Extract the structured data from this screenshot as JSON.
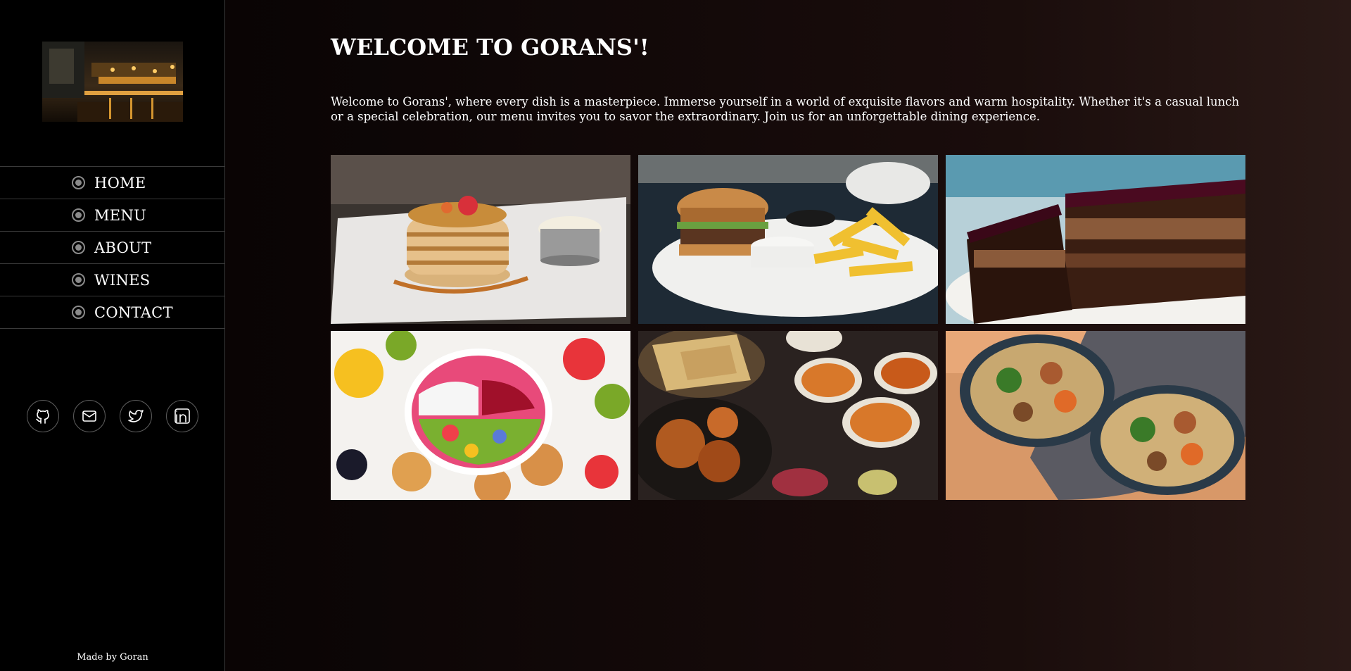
{
  "sidebar": {
    "logo": "restaurant-interior-photo",
    "nav": [
      {
        "label": "HOME"
      },
      {
        "label": "MENU"
      },
      {
        "label": "ABOUT"
      },
      {
        "label": "WINES"
      },
      {
        "label": "CONTACT"
      }
    ],
    "socials": [
      "github-icon",
      "mail-icon",
      "twitter-icon",
      "linkedin-icon"
    ],
    "credit": "Made by Goran"
  },
  "main": {
    "title": "WELCOME TO GORANS'!",
    "intro": "Welcome to Gorans', where every dish is a masterpiece. Immerse yourself in a world of exquisite flavors and warm hospitality. Whether it's a casual lunch or a special celebration, our menu invites you to savor the extraordinary. Join us for an unforgettable dining experience.",
    "gallery": [
      "pancakes-photo",
      "burger-fries-photo",
      "chocolate-cake-photo",
      "fruit-bowl-photo",
      "indian-dishes-photo",
      "noodle-bowls-photo"
    ]
  },
  "colors": {
    "sidebar_bg": "#000000",
    "divider": "#3a3a3a",
    "text": "#ffffff",
    "radio": "#8a8a8a"
  }
}
